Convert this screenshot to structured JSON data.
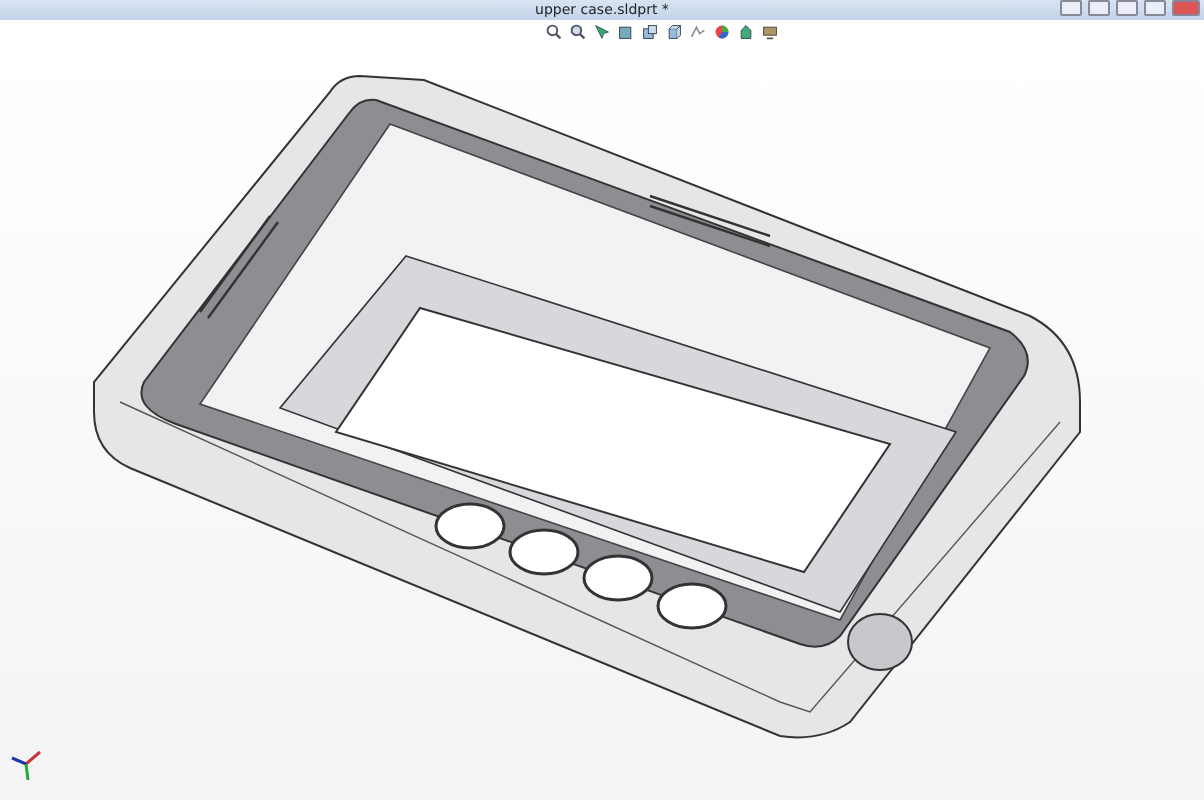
{
  "window": {
    "title": "upper case.sldprt *"
  }
}
